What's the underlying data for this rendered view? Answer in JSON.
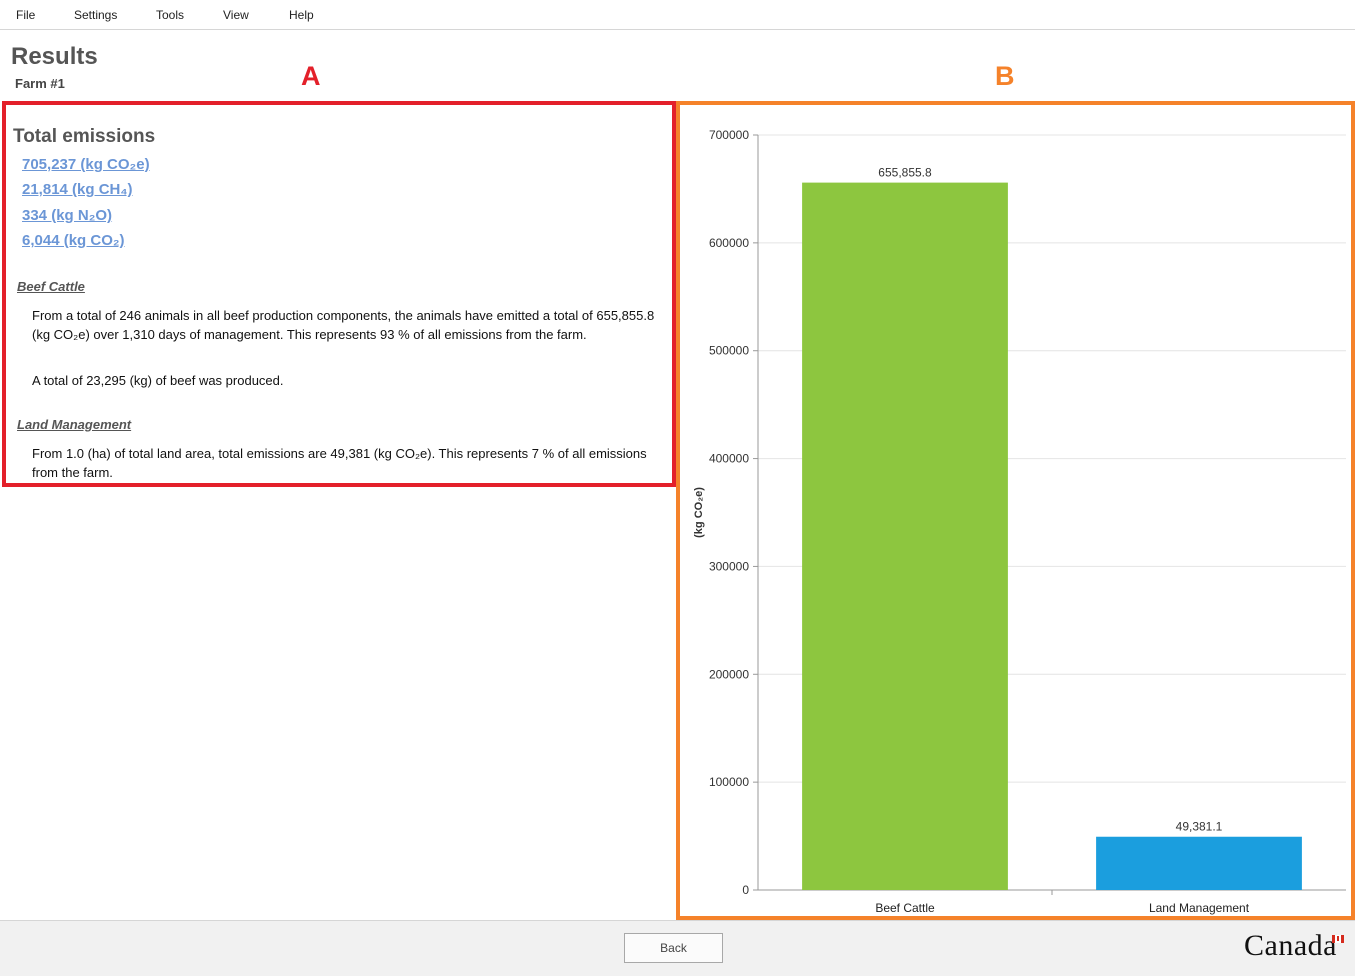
{
  "menu": {
    "items": [
      "File",
      "Settings",
      "Tools",
      "View",
      "Help"
    ]
  },
  "page": {
    "title": "Results",
    "subtitle": "Farm #1"
  },
  "annotations": {
    "a_label": "A",
    "a_color": "#e3202a",
    "b_label": "B",
    "b_color": "#f5822a"
  },
  "summary": {
    "heading": "Total emissions",
    "totals": [
      "705,237 (kg CO₂e)",
      "21,814 (kg CH₄)",
      "334 (kg N₂O)",
      "6,044 (kg CO₂)"
    ],
    "sections": [
      {
        "title": "Beef Cattle",
        "paragraphs": [
          "From a total of 246 animals in all beef production components, the animals have emitted a total of 655,855.8 (kg CO₂e) over 1,310 days of management. This represents 93 % of all emissions from the farm.",
          "A total of 23,295 (kg) of beef was produced."
        ]
      },
      {
        "title": "Land Management",
        "paragraphs": [
          "From 1.0 (ha) of total land area, total emissions are 49,381 (kg CO₂e). This represents 7 % of all emissions from the farm."
        ]
      }
    ]
  },
  "chart_data": {
    "type": "bar",
    "categories": [
      "Beef Cattle",
      "Land Management"
    ],
    "values": [
      655855.8,
      49381.1
    ],
    "data_labels": [
      "655,855.8",
      "49,381.1"
    ],
    "colors": [
      "#8dc63f",
      "#1b9ede"
    ],
    "ylabel": "(kg CO₂e)",
    "ylim": [
      0,
      700000
    ],
    "yticks": [
      0,
      100000,
      200000,
      300000,
      400000,
      500000,
      600000,
      700000
    ],
    "grid": true
  },
  "footer": {
    "back_label": "Back",
    "wordmark": "Canada"
  }
}
